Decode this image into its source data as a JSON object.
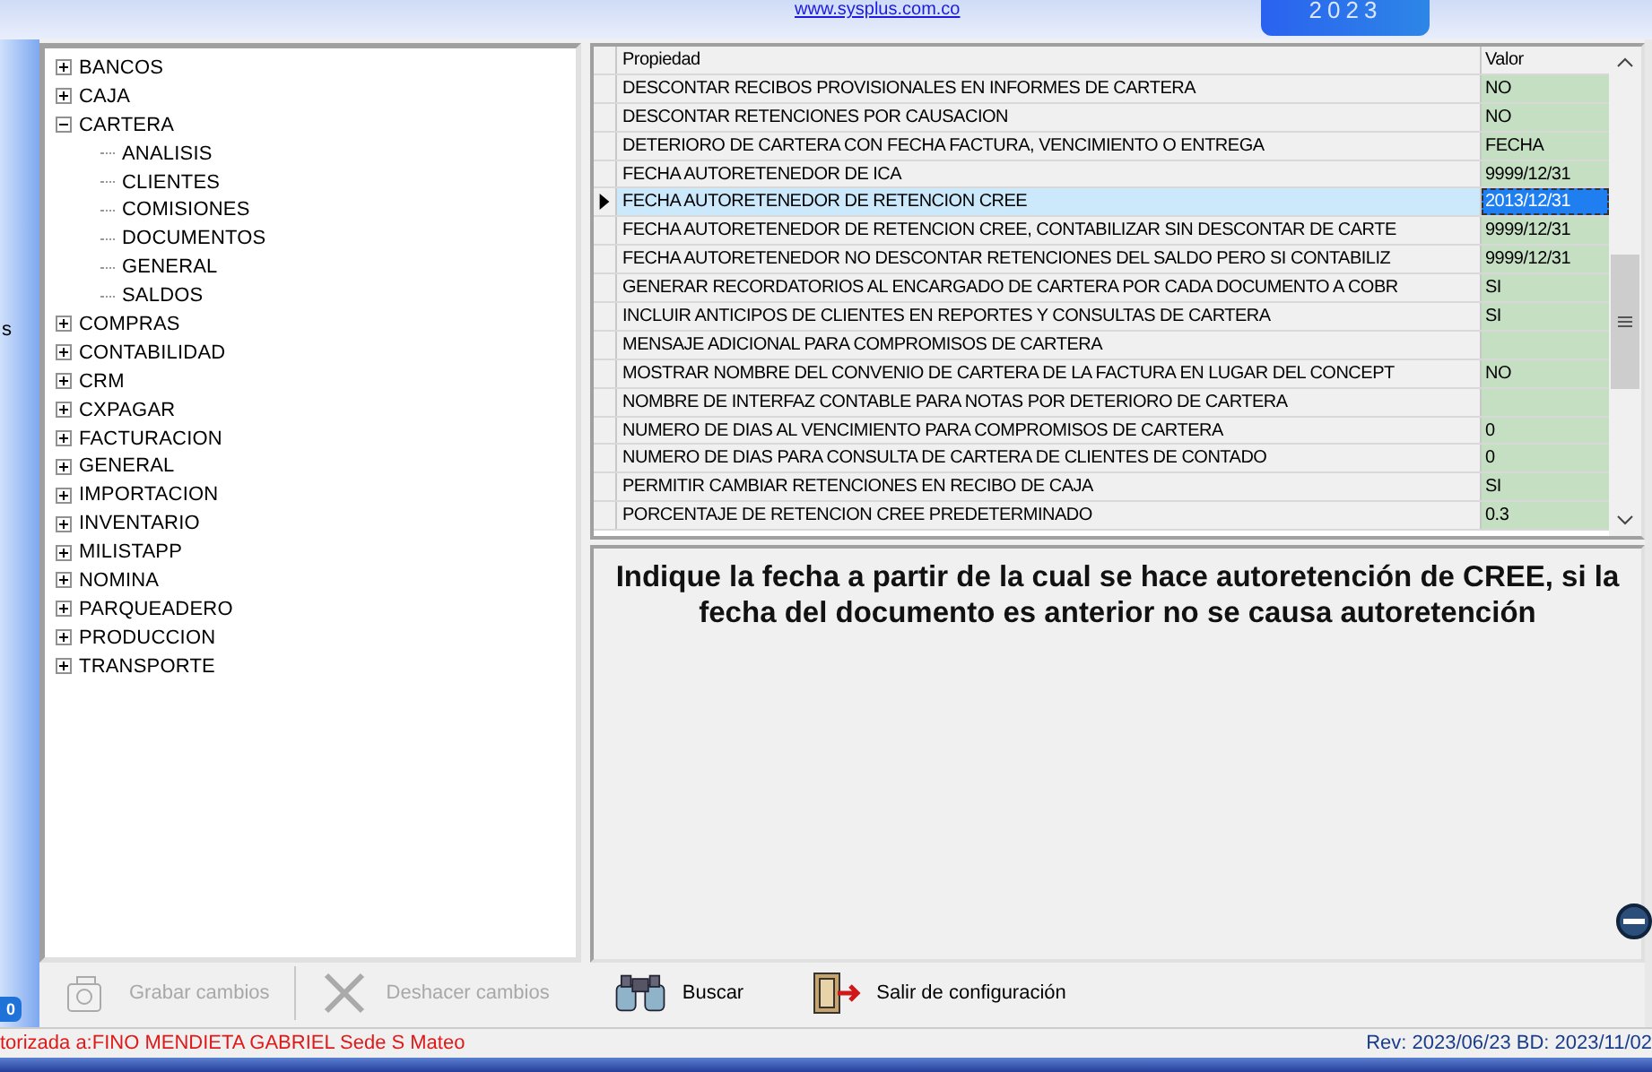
{
  "header": {
    "link": "www.sysplus.com.co",
    "year_badge": "2023"
  },
  "side_strip": {
    "edge_text": "s",
    "badge": "0"
  },
  "tree": [
    {
      "label": "BANCOS",
      "expanded": false
    },
    {
      "label": "CAJA",
      "expanded": false
    },
    {
      "label": "CARTERA",
      "expanded": true,
      "children": [
        {
          "label": "ANALISIS"
        },
        {
          "label": "CLIENTES"
        },
        {
          "label": "COMISIONES"
        },
        {
          "label": "DOCUMENTOS"
        },
        {
          "label": "GENERAL"
        },
        {
          "label": "SALDOS"
        }
      ]
    },
    {
      "label": "COMPRAS",
      "expanded": false
    },
    {
      "label": "CONTABILIDAD",
      "expanded": false
    },
    {
      "label": "CRM",
      "expanded": false
    },
    {
      "label": "CXPAGAR",
      "expanded": false
    },
    {
      "label": "FACTURACION",
      "expanded": false
    },
    {
      "label": "GENERAL",
      "expanded": false
    },
    {
      "label": "IMPORTACION",
      "expanded": false
    },
    {
      "label": "INVENTARIO",
      "expanded": false
    },
    {
      "label": "MILISTAPP",
      "expanded": false
    },
    {
      "label": "NOMINA",
      "expanded": false
    },
    {
      "label": "PARQUEADERO",
      "expanded": false
    },
    {
      "label": "PRODUCCION",
      "expanded": false
    },
    {
      "label": "TRANSPORTE",
      "expanded": false
    }
  ],
  "grid": {
    "columns": [
      "Propiedad",
      "Valor"
    ],
    "rows": [
      {
        "property": "DESCONTAR RECIBOS PROVISIONALES EN INFORMES DE CARTERA",
        "value": "NO",
        "selected": false
      },
      {
        "property": "DESCONTAR RETENCIONES POR CAUSACION",
        "value": "NO",
        "selected": false
      },
      {
        "property": "DETERIORO DE CARTERA CON FECHA FACTURA, VENCIMIENTO O ENTREGA",
        "value": "FECHA",
        "selected": false
      },
      {
        "property": "FECHA AUTORETENEDOR DE ICA",
        "value": "9999/12/31",
        "selected": false
      },
      {
        "property": "FECHA AUTORETENEDOR DE RETENCION CREE",
        "value": "2013/12/31",
        "selected": true
      },
      {
        "property": "FECHA AUTORETENEDOR DE RETENCION CREE, CONTABILIZAR SIN DESCONTAR DE CARTE",
        "value": "9999/12/31",
        "selected": false
      },
      {
        "property": "FECHA AUTORETENEDOR NO DESCONTAR RETENCIONES DEL SALDO PERO SI CONTABILIZ",
        "value": "9999/12/31",
        "selected": false
      },
      {
        "property": "GENERAR RECORDATORIOS AL ENCARGADO DE CARTERA POR CADA DOCUMENTO A COBR",
        "value": "SI",
        "selected": false
      },
      {
        "property": "INCLUIR ANTICIPOS DE CLIENTES EN REPORTES Y CONSULTAS DE CARTERA",
        "value": "SI",
        "selected": false
      },
      {
        "property": "MENSAJE ADICIONAL PARA COMPROMISOS DE CARTERA",
        "selected": false
      },
      {
        "property": "MOSTRAR NOMBRE DEL CONVENIO DE CARTERA DE LA FACTURA EN LUGAR DEL CONCEPT",
        "value": "NO",
        "selected": false
      },
      {
        "property": "NOMBRE DE INTERFAZ CONTABLE PARA NOTAS POR DETERIORO DE CARTERA",
        "selected": false
      },
      {
        "property": "NUMERO DE DIAS AL VENCIMIENTO PARA COMPROMISOS DE CARTERA",
        "value": "0",
        "selected": false
      },
      {
        "property": "NUMERO DE DIAS PARA CONSULTA DE CARTERA DE CLIENTES DE CONTADO",
        "value": "0",
        "selected": false
      },
      {
        "property": "PERMITIR CAMBIAR RETENCIONES EN RECIBO DE CAJA",
        "value": "SI",
        "selected": false
      },
      {
        "property": "PORCENTAJE DE RETENCION CREE PREDETERMINADO",
        "value": "0.3",
        "selected": false
      }
    ]
  },
  "description": "Indique la fecha a partir de la cual se hace autoretención de CREE, si la fecha del documento es anterior no se causa autoretención",
  "toolbar": [
    {
      "kind": "save",
      "label": "Grabar cambios",
      "disabled": true
    },
    {
      "kind": "undo",
      "label": "Deshacer cambios",
      "disabled": true
    },
    {
      "kind": "search",
      "label": "Buscar",
      "disabled": false
    },
    {
      "kind": "exit",
      "label": "Salir de configuración",
      "disabled": false
    }
  ],
  "status_bar": {
    "license": "torizada a:FINO MENDIETA GABRIEL Sede S Mateo",
    "revision": "Rev: 2023/06/23 BD: 2023/11/02"
  }
}
